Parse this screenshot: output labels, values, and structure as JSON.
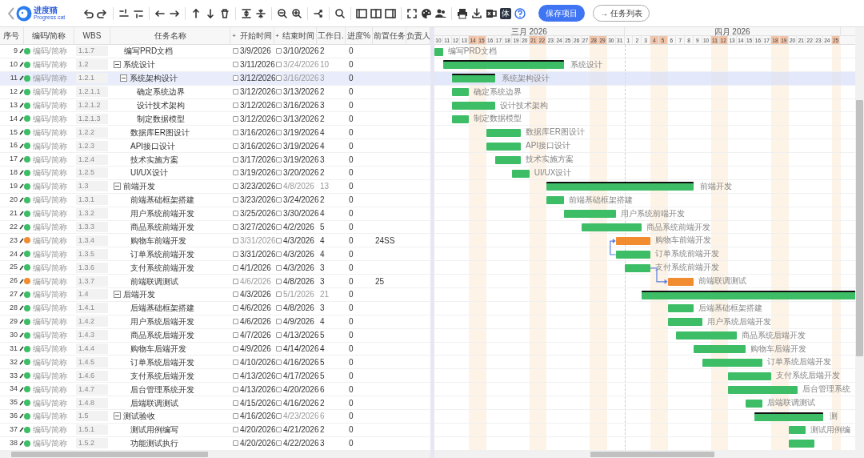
{
  "toolbar": {
    "logo": {
      "name": "进度猫",
      "tagline": "Progress cat"
    },
    "glyph": "体",
    "buttons": [
      {
        "label": "保存项目",
        "kind": "primary"
      },
      {
        "label": "→ 任务列表",
        "kind": "outline"
      }
    ]
  },
  "columns": [
    {
      "label": "序号",
      "kind": "text"
    },
    {
      "label": "编码/简称",
      "kind": "text"
    },
    {
      "label": "WBS",
      "kind": "text"
    },
    {
      "label": "任务名称",
      "kind": "text"
    },
    {
      "label": "+",
      "kind": "add"
    },
    {
      "label": "开始时间",
      "kind": "text"
    },
    {
      "label": "+",
      "kind": "add"
    },
    {
      "label": "结束时间",
      "kind": "text"
    },
    {
      "label": "工作日.",
      "kind": "text"
    },
    {
      "label": "进度%",
      "kind": "text"
    },
    {
      "label": "前置任务",
      "kind": "text"
    },
    {
      "label": "负责人",
      "kind": "text"
    }
  ],
  "timeline": {
    "months": [
      {
        "label": "三月 2026",
        "days": [
          {
            "label": "10",
            "weekend": false
          },
          {
            "label": "11",
            "weekend": false
          },
          {
            "label": "12",
            "weekend": false
          },
          {
            "label": "13",
            "weekend": false
          },
          {
            "label": "14",
            "weekend": true
          },
          {
            "label": "15",
            "weekend": true
          },
          {
            "label": "16",
            "weekend": false
          },
          {
            "label": "17",
            "weekend": false
          },
          {
            "label": "18",
            "weekend": false
          },
          {
            "label": "19",
            "weekend": false
          },
          {
            "label": "20",
            "weekend": false
          },
          {
            "label": "21",
            "weekend": true
          },
          {
            "label": "22",
            "weekend": true
          },
          {
            "label": "23",
            "weekend": false
          },
          {
            "label": "24",
            "weekend": false
          },
          {
            "label": "25",
            "weekend": false
          },
          {
            "label": "26",
            "weekend": false
          },
          {
            "label": "27",
            "weekend": false
          },
          {
            "label": "28",
            "weekend": true
          },
          {
            "label": "29",
            "weekend": true
          },
          {
            "label": "30",
            "weekend": false
          },
          {
            "label": "31",
            "weekend": false
          }
        ]
      },
      {
        "label": "四月 2026",
        "days": [
          {
            "label": "1",
            "weekend": false
          },
          {
            "label": "2",
            "weekend": false
          },
          {
            "label": "3",
            "weekend": false
          },
          {
            "label": "4",
            "weekend": true
          },
          {
            "label": "5",
            "weekend": true
          },
          {
            "label": "6",
            "weekend": false
          },
          {
            "label": "7",
            "weekend": false
          },
          {
            "label": "8",
            "weekend": false
          },
          {
            "label": "9",
            "weekend": false
          },
          {
            "label": "10",
            "weekend": false
          },
          {
            "label": "11",
            "weekend": true
          },
          {
            "label": "12",
            "weekend": true
          },
          {
            "label": "13",
            "weekend": false
          },
          {
            "label": "14",
            "weekend": false
          },
          {
            "label": "15",
            "weekend": false
          },
          {
            "label": "16",
            "weekend": false
          },
          {
            "label": "17",
            "weekend": false
          },
          {
            "label": "18",
            "weekend": true
          },
          {
            "label": "19",
            "weekend": true
          },
          {
            "label": "20",
            "weekend": false
          },
          {
            "label": "21",
            "weekend": false
          },
          {
            "label": "22",
            "weekend": false
          },
          {
            "label": "23",
            "weekend": false
          },
          {
            "label": "24",
            "weekend": false
          },
          {
            "label": "25",
            "weekend": true
          }
        ]
      }
    ]
  },
  "tasks": [
    {
      "no": "9",
      "color": "#3dbd66",
      "code": "编码/简称",
      "wbs": "1.1.7",
      "name": "编写PRD文档",
      "start": "3/9/2026",
      "end": "3/10/2026",
      "workdays": "2",
      "progress": "0",
      "start_disabled": false,
      "end_disabled": false,
      "selected": false,
      "bar_label": "编写PRD文档"
    },
    {
      "no": "10",
      "color": "#3dbd66",
      "code": "编码/简称",
      "wbs": "1.2",
      "name": "系统设计",
      "start": "3/11/2026",
      "end": "3/24/2026",
      "workdays": "10",
      "progress": "0",
      "start_disabled": false,
      "end_disabled": true,
      "selected": false,
      "expanded": true,
      "bar_label": "系统设计",
      "children": [
        {
          "no": "11",
          "color": "#3dbd66",
          "code": "编码/简称",
          "wbs": "1.2.1",
          "name": "系统架构设计",
          "start": "3/12/2026",
          "end": "3/16/2026",
          "workdays": "3",
          "progress": "0",
          "start_disabled": false,
          "end_disabled": true,
          "selected": true,
          "expanded": true,
          "bar_label": "系统架构设计",
          "children": [
            {
              "no": "12",
              "color": "#3dbd66",
              "code": "编码/简称",
              "wbs": "1.2.1.1",
              "name": "确定系统边界",
              "start": "3/12/2026",
              "end": "3/13/2026",
              "workdays": "2",
              "progress": "0",
              "start_disabled": false,
              "end_disabled": false,
              "selected": false,
              "bar_label": "确定系统边界"
            },
            {
              "no": "13",
              "color": "#3dbd66",
              "code": "编码/简称",
              "wbs": "1.2.1.2",
              "name": "设计技术架构",
              "start": "3/12/2026",
              "end": "3/16/2026",
              "workdays": "3",
              "progress": "0",
              "start_disabled": false,
              "end_disabled": false,
              "selected": false,
              "bar_label": "设计技术架构"
            },
            {
              "no": "14",
              "color": "#3dbd66",
              "code": "编码/简称",
              "wbs": "1.2.1.3",
              "name": "制定数据模型",
              "start": "3/12/2026",
              "end": "3/13/2026",
              "workdays": "2",
              "progress": "0",
              "start_disabled": false,
              "end_disabled": false,
              "selected": false,
              "bar_label": "制定数据模型"
            }
          ]
        },
        {
          "no": "15",
          "color": "#3dbd66",
          "code": "编码/简称",
          "wbs": "1.2.2",
          "name": "数据库ER图设计",
          "start": "3/16/2026",
          "end": "3/19/2026",
          "workdays": "4",
          "progress": "0",
          "start_disabled": false,
          "end_disabled": false,
          "selected": false,
          "bar_label": "数据库ER图设计"
        },
        {
          "no": "16",
          "color": "#3dbd66",
          "code": "编码/简称",
          "wbs": "1.2.3",
          "name": "API接口设计",
          "start": "3/16/2026",
          "end": "3/19/2026",
          "workdays": "4",
          "progress": "0",
          "start_disabled": false,
          "end_disabled": false,
          "selected": false,
          "bar_label": "API接口设计"
        },
        {
          "no": "17",
          "color": "#3dbd66",
          "code": "编码/简称",
          "wbs": "1.2.4",
          "name": "技术实施方案",
          "start": "3/17/2026",
          "end": "3/19/2026",
          "workdays": "3",
          "progress": "0",
          "start_disabled": false,
          "end_disabled": false,
          "selected": false,
          "bar_label": "技术实施方案"
        },
        {
          "no": "18",
          "color": "#3dbd66",
          "code": "编码/简称",
          "wbs": "1.2.5",
          "name": "UI/UX设计",
          "start": "3/19/2026",
          "end": "3/20/2026",
          "workdays": "2",
          "progress": "0",
          "start_disabled": false,
          "end_disabled": false,
          "selected": false,
          "bar_label": "UI/UX设计"
        }
      ]
    },
    {
      "no": "19",
      "color": "#3dbd66",
      "code": "编码/简称",
      "wbs": "1.3",
      "name": "前端开发",
      "start": "3/23/2026",
      "end": "4/8/2026",
      "workdays": "13",
      "progress": "0",
      "start_disabled": false,
      "end_disabled": true,
      "selected": false,
      "expanded": true,
      "bar_label": "前端开发",
      "children": [
        {
          "no": "20",
          "color": "#3dbd66",
          "code": "编码/简称",
          "wbs": "1.3.1",
          "name": "前端基础框架搭建",
          "start": "3/23/2026",
          "end": "3/24/2026",
          "workdays": "2",
          "progress": "0",
          "start_disabled": false,
          "end_disabled": false,
          "selected": false,
          "bar_label": "前端基础框架搭建"
        },
        {
          "no": "21",
          "color": "#3dbd66",
          "code": "编码/简称",
          "wbs": "1.3.2",
          "name": "用户系统前端开发",
          "start": "3/25/2026",
          "end": "3/30/2026",
          "workdays": "4",
          "progress": "0",
          "start_disabled": false,
          "end_disabled": false,
          "selected": false,
          "bar_label": "用户系统前端开发"
        },
        {
          "no": "22",
          "color": "#3dbd66",
          "code": "编码/简称",
          "wbs": "1.3.3",
          "name": "商品系统前端开发",
          "start": "3/27/2026",
          "end": "4/2/2026",
          "workdays": "5",
          "progress": "0",
          "start_disabled": false,
          "end_disabled": false,
          "selected": false,
          "bar_label": "商品系统前端开发"
        },
        {
          "no": "23",
          "color": "#f28c30",
          "code": "编码/简称",
          "wbs": "1.3.4",
          "name": "购物车前端开发",
          "start": "3/31/2026",
          "end": "4/3/2026",
          "workdays": "4",
          "progress": "0",
          "predecessor": "24SS",
          "start_disabled": true,
          "end_disabled": false,
          "selected": false,
          "bar_label": "购物车前端开发"
        },
        {
          "no": "24",
          "color": "#3dbd66",
          "code": "编码/简称",
          "wbs": "1.3.5",
          "name": "订单系统前端开发",
          "start": "3/31/2026",
          "end": "4/3/2026",
          "workdays": "4",
          "progress": "0",
          "start_disabled": false,
          "end_disabled": false,
          "selected": false,
          "bar_label": "订单系统前端开发"
        },
        {
          "no": "25",
          "color": "#3dbd66",
          "code": "编码/简称",
          "wbs": "1.3.6",
          "name": "支付系统前端开发",
          "start": "4/1/2026",
          "end": "4/3/2026",
          "workdays": "3",
          "progress": "0",
          "start_disabled": false,
          "end_disabled": false,
          "selected": false,
          "bar_label": "支付系统前端开发"
        },
        {
          "no": "26",
          "color": "#f28c30",
          "code": "编码/简称",
          "wbs": "1.3.7",
          "name": "前端联调测试",
          "start": "4/6/2026",
          "end": "4/8/2026",
          "workdays": "3",
          "progress": "0",
          "predecessor": "25",
          "start_disabled": true,
          "end_disabled": false,
          "selected": false,
          "bar_label": "前端联调测试"
        }
      ]
    },
    {
      "no": "27",
      "color": "#3dbd66",
      "code": "编码/简称",
      "wbs": "1.4",
      "name": "后端开发",
      "start": "4/3/2026",
      "end": "5/1/2026",
      "workdays": "21",
      "progress": "0",
      "start_disabled": false,
      "end_disabled": true,
      "selected": false,
      "expanded": true,
      "children": [
        {
          "no": "28",
          "color": "#3dbd66",
          "code": "编码/简称",
          "wbs": "1.4.1",
          "name": "后端基础框架搭建",
          "start": "4/6/2026",
          "end": "4/8/2026",
          "workdays": "3",
          "progress": "0",
          "start_disabled": false,
          "end_disabled": false,
          "selected": false,
          "bar_label": "后端基础框架搭建"
        },
        {
          "no": "29",
          "color": "#3dbd66",
          "code": "编码/简称",
          "wbs": "1.4.2",
          "name": "用户系统后端开发",
          "start": "4/6/2026",
          "end": "4/9/2026",
          "workdays": "4",
          "progress": "0",
          "start_disabled": false,
          "end_disabled": false,
          "selected": false,
          "bar_label": "用户系统后端开发"
        },
        {
          "no": "30",
          "color": "#3dbd66",
          "code": "编码/简称",
          "wbs": "1.4.3",
          "name": "商品系统后端开发",
          "start": "4/7/2026",
          "end": "4/13/2026",
          "workdays": "5",
          "progress": "0",
          "start_disabled": false,
          "end_disabled": false,
          "selected": false,
          "bar_label": "商品系统后端开发"
        },
        {
          "no": "31",
          "color": "#3dbd66",
          "code": "编码/简称",
          "wbs": "1.4.4",
          "name": "购物车后端开发",
          "start": "4/9/2026",
          "end": "4/14/2026",
          "workdays": "4",
          "progress": "0",
          "start_disabled": false,
          "end_disabled": false,
          "selected": false,
          "bar_label": "购物车后端开发"
        },
        {
          "no": "32",
          "color": "#3dbd66",
          "code": "编码/简称",
          "wbs": "1.4.5",
          "name": "订单系统后端开发",
          "start": "4/10/2026",
          "end": "4/16/2026",
          "workdays": "5",
          "progress": "0",
          "start_disabled": false,
          "end_disabled": false,
          "selected": false,
          "bar_label": "订单系统后端开发"
        },
        {
          "no": "33",
          "color": "#3dbd66",
          "code": "编码/简称",
          "wbs": "1.4.6",
          "name": "支付系统后端开发",
          "start": "4/13/2026",
          "end": "4/17/2026",
          "workdays": "5",
          "progress": "0",
          "start_disabled": false,
          "end_disabled": false,
          "selected": false,
          "bar_label": "支付系统后端开发"
        },
        {
          "no": "34",
          "color": "#3dbd66",
          "code": "编码/简称",
          "wbs": "1.4.7",
          "name": "后台管理系统开发",
          "start": "4/13/2026",
          "end": "4/20/2026",
          "workdays": "6",
          "progress": "0",
          "start_disabled": false,
          "end_disabled": false,
          "selected": false,
          "bar_label": "后台管理系统"
        },
        {
          "no": "35",
          "color": "#3dbd66",
          "code": "编码/简称",
          "wbs": "1.4.8",
          "name": "后端联调测试",
          "start": "4/15/2026",
          "end": "4/16/2026",
          "workdays": "2",
          "progress": "0",
          "start_disabled": false,
          "end_disabled": false,
          "selected": false,
          "bar_label": "后端联调测试"
        }
      ]
    },
    {
      "no": "36",
      "color": "#3dbd66",
      "code": "编码/简称",
      "wbs": "1.5",
      "name": "测试验收",
      "start": "4/16/2026",
      "end": "4/23/2026",
      "workdays": "6",
      "progress": "0",
      "start_disabled": false,
      "end_disabled": true,
      "selected": false,
      "expanded": true,
      "bar_label": "测",
      "children": [
        {
          "no": "37",
          "color": "#3dbd66",
          "code": "编码/简称",
          "wbs": "1.5.1",
          "name": "测试用例编写",
          "start": "4/20/2026",
          "end": "4/21/2026",
          "workdays": "2",
          "progress": "0",
          "start_disabled": false,
          "end_disabled": false,
          "selected": false,
          "bar_label": "测试用例编"
        },
        {
          "no": "38",
          "color": "#3dbd66",
          "code": "编码/简称",
          "wbs": "1.5.2",
          "name": "功能测试执行",
          "start": "4/20/2026",
          "end": "4/22/2026",
          "workdays": "3",
          "progress": "0",
          "start_disabled": false,
          "end_disabled": false,
          "selected": false
        }
      ]
    }
  ]
}
